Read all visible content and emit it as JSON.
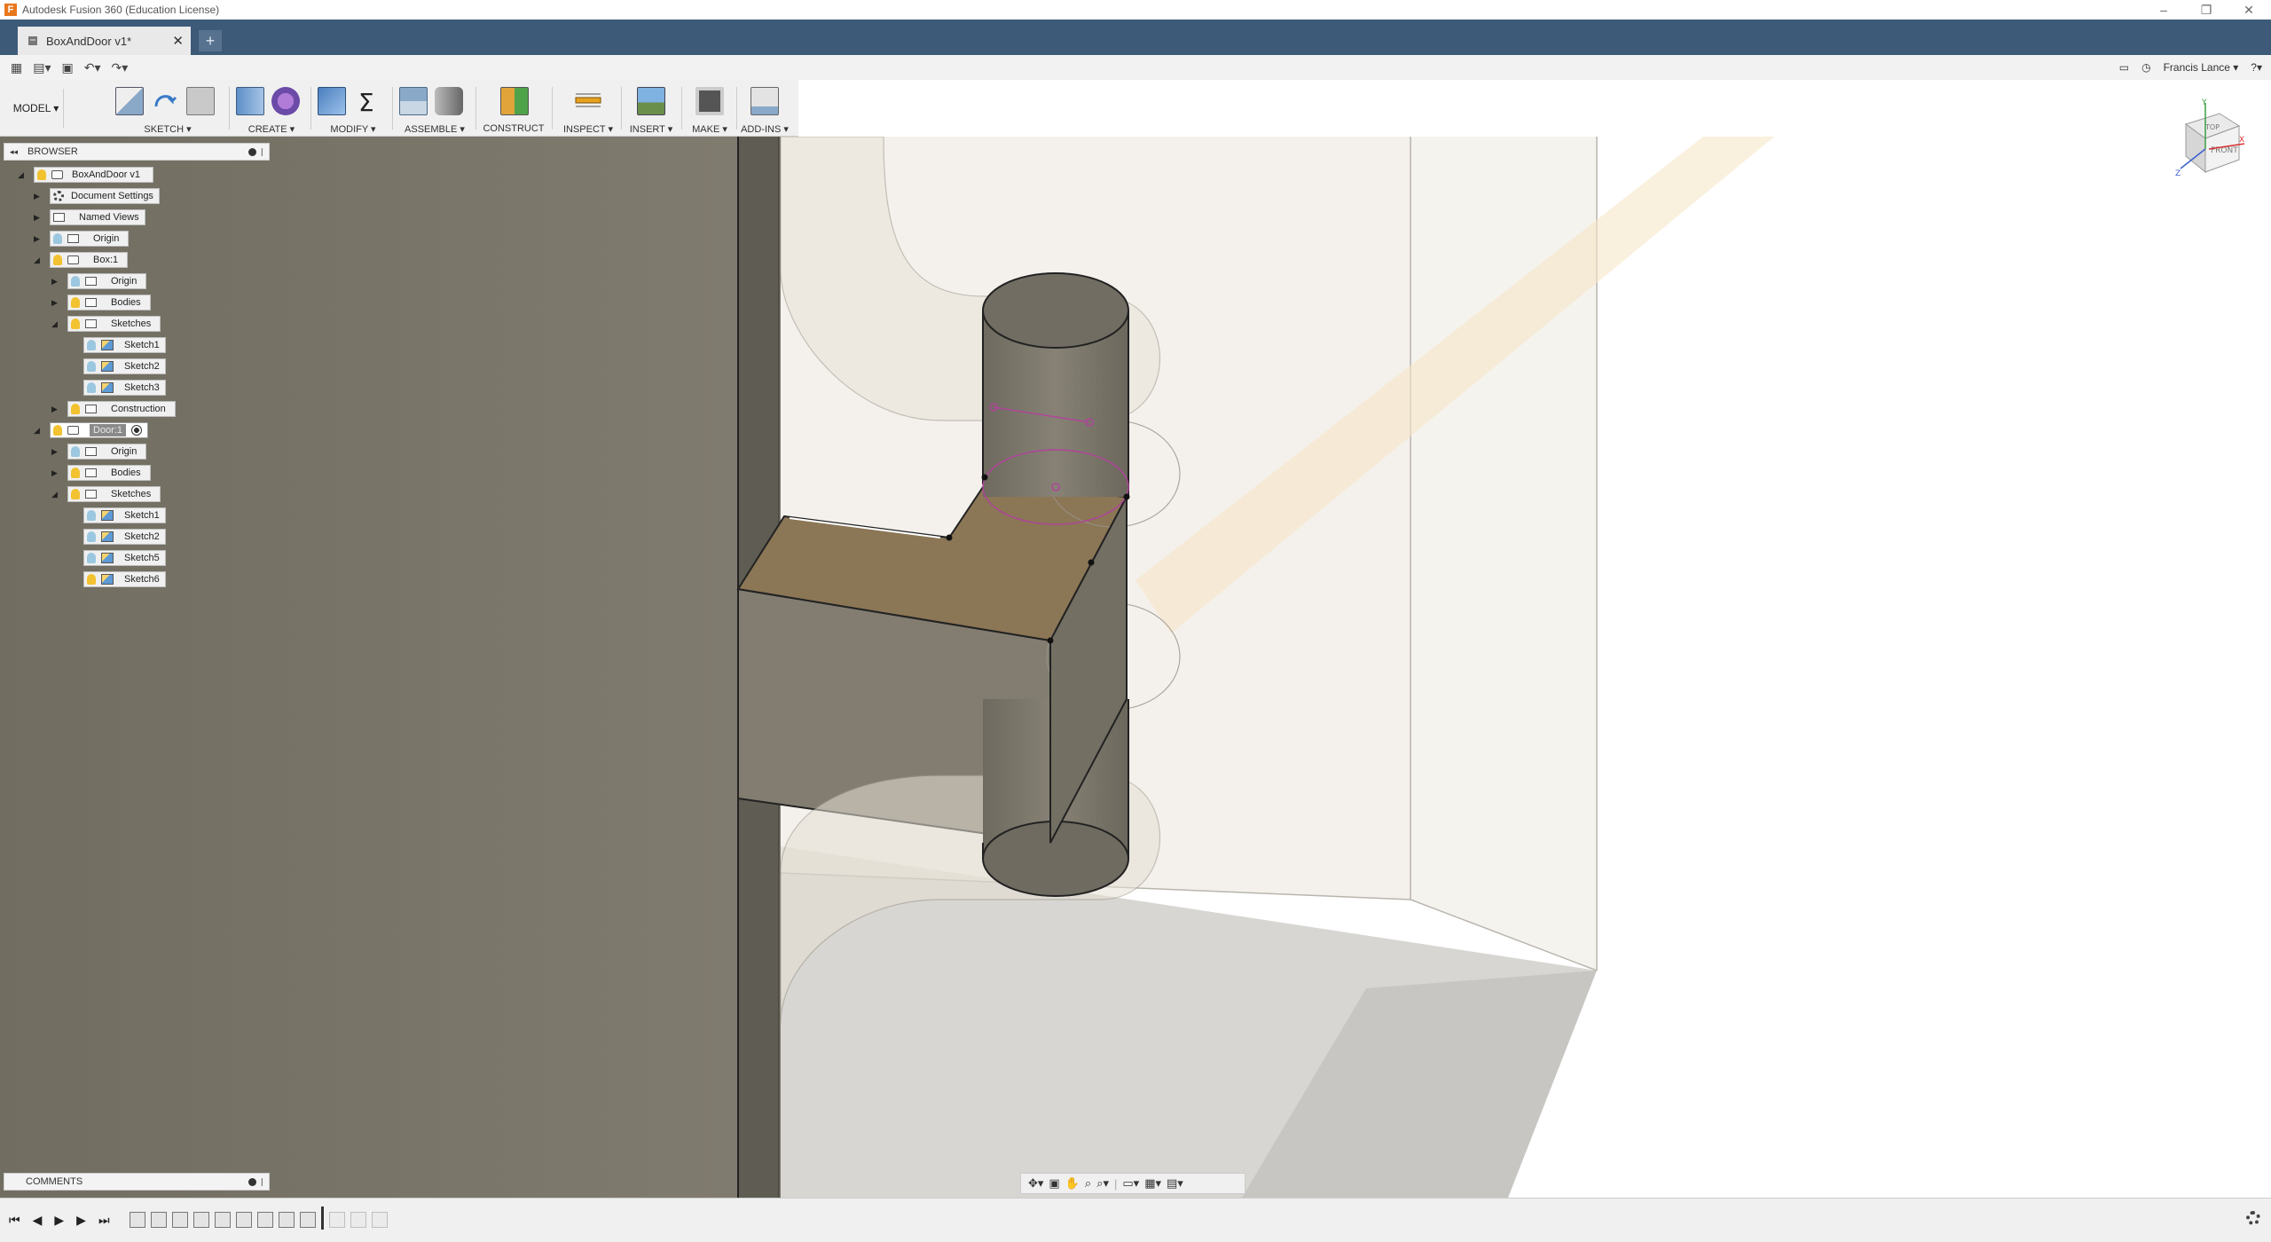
{
  "window": {
    "title": "Autodesk Fusion 360 (Education License)",
    "minimize": "–",
    "restore": "❐",
    "close": "✕"
  },
  "document_tab": {
    "label": "BoxAndDoor v1*",
    "close": "✕",
    "new_tab": "+"
  },
  "quick_access": {
    "grid": "▦",
    "file": "▤▾",
    "save": "▣",
    "undo": "↶▾",
    "redo": "↷▾"
  },
  "top_right": {
    "notifications_icon": "▭",
    "history_icon": "◷",
    "user": "Francis Lance ▾",
    "help": "?▾"
  },
  "toolbar": {
    "workspace": "MODEL ▾",
    "groups": [
      {
        "label": "SKETCH ▾"
      },
      {
        "label": "CREATE ▾"
      },
      {
        "label": "MODIFY ▾"
      },
      {
        "label": "ASSEMBLE ▾"
      },
      {
        "label": "CONSTRUCT ▾"
      },
      {
        "label": "INSPECT ▾"
      },
      {
        "label": "INSERT ▾"
      },
      {
        "label": "MAKE ▾"
      },
      {
        "label": "ADD-INS ▾"
      }
    ]
  },
  "browser": {
    "title": "BROWSER",
    "collapse": "◂◂",
    "items": [
      {
        "label": "BoxAndDoor v1",
        "expander": "◢"
      },
      {
        "label": "Document Settings",
        "expander": "▶"
      },
      {
        "label": "Named Views",
        "expander": "▶"
      },
      {
        "label": "Origin",
        "expander": "▶"
      },
      {
        "label": "Box:1",
        "expander": "◢"
      },
      {
        "label": "Origin",
        "expander": "▶"
      },
      {
        "label": "Bodies",
        "expander": "▶"
      },
      {
        "label": "Sketches",
        "expander": "◢"
      },
      {
        "label": "Sketch1",
        "expander": ""
      },
      {
        "label": "Sketch2",
        "expander": ""
      },
      {
        "label": "Sketch3",
        "expander": ""
      },
      {
        "label": "Construction",
        "expander": "▶"
      },
      {
        "label": "Door:1",
        "expander": "◢"
      },
      {
        "label": "Origin",
        "expander": "▶"
      },
      {
        "label": "Bodies",
        "expander": "▶"
      },
      {
        "label": "Sketches",
        "expander": "◢"
      },
      {
        "label": "Sketch1",
        "expander": ""
      },
      {
        "label": "Sketch2",
        "expander": ""
      },
      {
        "label": "Sketch5",
        "expander": ""
      },
      {
        "label": "Sketch6",
        "expander": ""
      }
    ]
  },
  "comments": {
    "title": "COMMENTS"
  },
  "viewcube": {
    "top": "TOP",
    "front": "FRONT",
    "axis_x": "X",
    "axis_y": "Y",
    "axis_z": "Z"
  },
  "navbar": {
    "orbit": "✥▾",
    "look": "▣",
    "pan": "✋",
    "zoom_window": "⌕",
    "zoom": "⌕▾",
    "display": "▭▾",
    "grid": "▦▾",
    "viewports": "▤▾"
  },
  "timeline": {
    "first": "⏮",
    "prev": "◀",
    "play": "▶",
    "next": "▶",
    "last": "⏭"
  },
  "colors": {
    "tab_bar": "#3d5a78",
    "bulb_on": "#f2c230",
    "bulb_off": "#9cc7e0",
    "model_body": "#787466"
  }
}
